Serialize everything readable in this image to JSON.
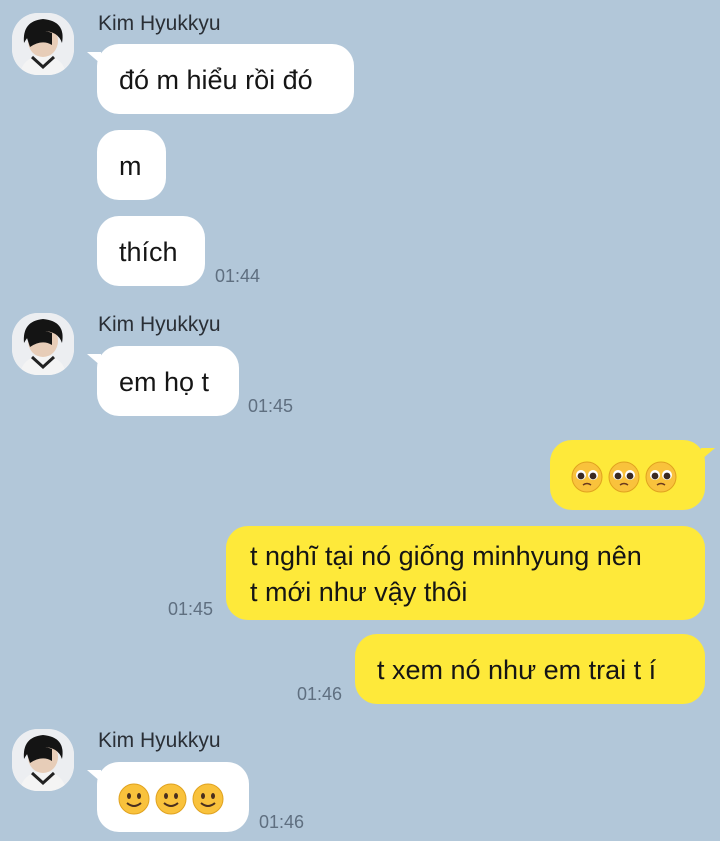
{
  "colors": {
    "background": "#b2c7d9",
    "incoming_bubble": "#ffffff",
    "outgoing_bubble": "#fee93a",
    "timestamp": "#5f6f80"
  },
  "groups": [
    {
      "sender": "Kim Hyukkyu",
      "avatar_icon": "profile-photo",
      "messages": [
        "đó m hiểu rồi đó",
        "m",
        "thích"
      ],
      "time": "01:44"
    },
    {
      "sender": "Kim Hyukkyu",
      "avatar_icon": "profile-photo",
      "messages": [
        "em họ t"
      ],
      "time": "01:45"
    },
    {
      "outgoing": true,
      "messages": [
        {
          "emoji": [
            "pleading-face-emoji",
            "pleading-face-emoji",
            "pleading-face-emoji"
          ]
        },
        {
          "lines": [
            "t nghĩ tại nó giống minhyung nên",
            "t mới như vậy thôi"
          ],
          "time": "01:45"
        },
        {
          "text": "t xem nó như em trai t í",
          "time": "01:46"
        }
      ]
    },
    {
      "sender": "Kim Hyukkyu",
      "avatar_icon": "profile-photo",
      "messages": [
        {
          "emoji": [
            "slightly-smiling-face-emoji",
            "slightly-smiling-face-emoji",
            "slightly-smiling-face-emoji"
          ]
        }
      ],
      "time": "01:46"
    }
  ]
}
